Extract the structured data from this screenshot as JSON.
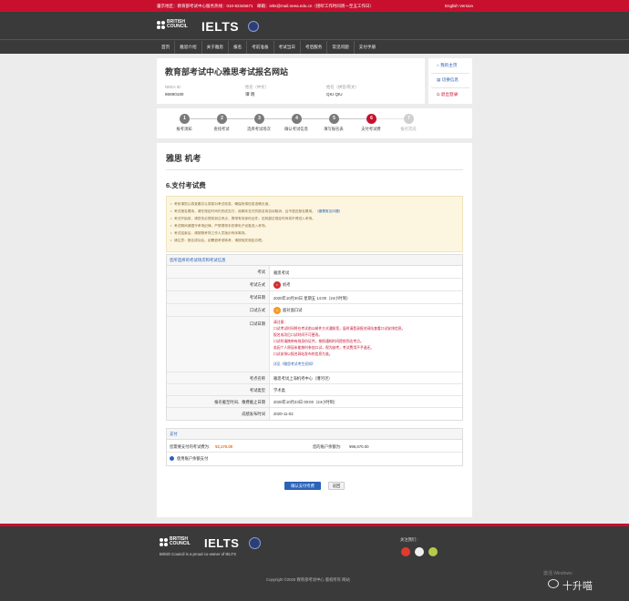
{
  "topbar": {
    "contact": "肇京地区：教育部考试中心服务热线：010-82345671　邮箱：ielts@mail.neea.edu.cn（接听工作时间周一至五工作日）",
    "language_link": "English Version"
  },
  "brand": {
    "british_council": [
      "BRITISH",
      "COUNCIL"
    ],
    "ielts": "IELTS"
  },
  "nav": [
    "首页",
    "雅思介绍",
    "关于雅思",
    "报名",
    "考前准备",
    "考试当日",
    "考后服务",
    "常见问题",
    "支付手册"
  ],
  "site_header": {
    "title": "教育部考试中心雅思考试报名网站",
    "fields": [
      {
        "label": "NEEA ID",
        "value": "86690180"
      },
      {
        "label": "姓名（中文）",
        "value": "谭 晓"
      },
      {
        "label": "姓名（拼音/英文）",
        "value": "QIU QIU"
      }
    ]
  },
  "side_menu": [
    {
      "label": "我的主页",
      "icon": "home-icon"
    },
    {
      "label": "切换信息",
      "icon": "switch-icon"
    },
    {
      "label": "退出登录",
      "icon": "power-icon"
    }
  ],
  "steps": [
    {
      "num": "1",
      "label": "报考须知",
      "state": "done"
    },
    {
      "num": "2",
      "label": "查找考试",
      "state": "done"
    },
    {
      "num": "3",
      "label": "选择考试场次",
      "state": "done"
    },
    {
      "num": "4",
      "label": "确认考试信息",
      "state": "done"
    },
    {
      "num": "5",
      "label": "填写报名表",
      "state": "done"
    },
    {
      "num": "6",
      "label": "支付考试费",
      "state": "current"
    },
    {
      "num": "7",
      "label": "报名完成",
      "state": "todo"
    }
  ],
  "page": {
    "title": "雅思 机考",
    "section": "6.支付考试费"
  },
  "notices": [
    {
      "text": "考前请您认真查看并认真核对考试信息，确保所填信息准确无误。"
    },
    {
      "text": "考试报名费用，请在规定时间内完成支付，逾期未支付的报名将自动取消，且不退还报名费用。",
      "link": "（缴费常见问题）"
    },
    {
      "text": "考试开始前，请您务必提前到达考点，携带有效身份证件；迟到超过规定时间将不得进入考场。"
    },
    {
      "text": "考试期间请遵守考场纪律，严禁携带手机等电子设备进入考场。"
    },
    {
      "text": "考试结束后，请按照考场工作人员指示有序离场。"
    },
    {
      "text": "请注意：报名成功后，如需退考或转考，请按相关规定办理。"
    }
  ],
  "exam_info": {
    "header": "您所选择的考试场次和考试信息",
    "rows": {
      "exam_label": "考试",
      "exam_value": "雅思考试",
      "mode_label": "考试方式",
      "mode_value": "机考",
      "date_label": "考试日期",
      "date_value": "2020年10月30日 星期五 14:00（24小时制）",
      "oral_mode_label": "口试方式",
      "oral_mode_value": "面对面口试",
      "oral_date_label": "口试日期",
      "oral_note_title": "请注意：",
      "oral_notes": [
        "口试考试时间将在考试前以邮件方式通知您，届时请登录报名网站查看口试安排信息。",
        "报名成功后口试时间不可更改。",
        "口试时请携带有效身份证件，按照通知时间提前到达考点。",
        "若因个人原因未能按时参加口试，视为缺考，考试费用不予退还。",
        "口试安排以报名网站发布的信息为准。"
      ],
      "oral_link": "详见《雅思考试考生须知》",
      "venue_label": "考点名称",
      "venue_value": "雅思考试上海机考中心（漕河泾）",
      "type_label": "考试类型",
      "type_value": "学术类",
      "deadline_label": "报名截至时间、缴费截止日期",
      "deadline_value": "2020年10月23日 00:00（24小时制）",
      "result_label": "成绩发布时间",
      "result_value": "2020-11-02"
    }
  },
  "payment": {
    "header": "支付",
    "total_label": "您需要支付的考试费为:",
    "total_value": "¥2,170.00",
    "balance_label": "您的账户余额为:",
    "balance_value": "¥96,670.00",
    "use_account_label": "使用账户余额支付"
  },
  "buttons": {
    "confirm": "确认支付考费",
    "back": "返回"
  },
  "footer": {
    "british_council": [
      "BRITISH",
      "COUNCIL"
    ],
    "ielts": "IELTS",
    "tagline": "British Council is a proud co-owner of IELTS",
    "follow": "关注我们：",
    "copyright": "Copyright ©2020 教育部考试中心 版权所有 网站"
  },
  "watermark": {
    "activate": "激活 Windows",
    "weibo": "十升喵"
  },
  "colors": {
    "brand_red": "#c8102e",
    "dark_bar": "#3a3a3a",
    "link_blue": "#2a5db0",
    "button_blue": "#2a63b8",
    "notice_bg": "#fcf5e0",
    "price_orange": "#e06a1b"
  }
}
